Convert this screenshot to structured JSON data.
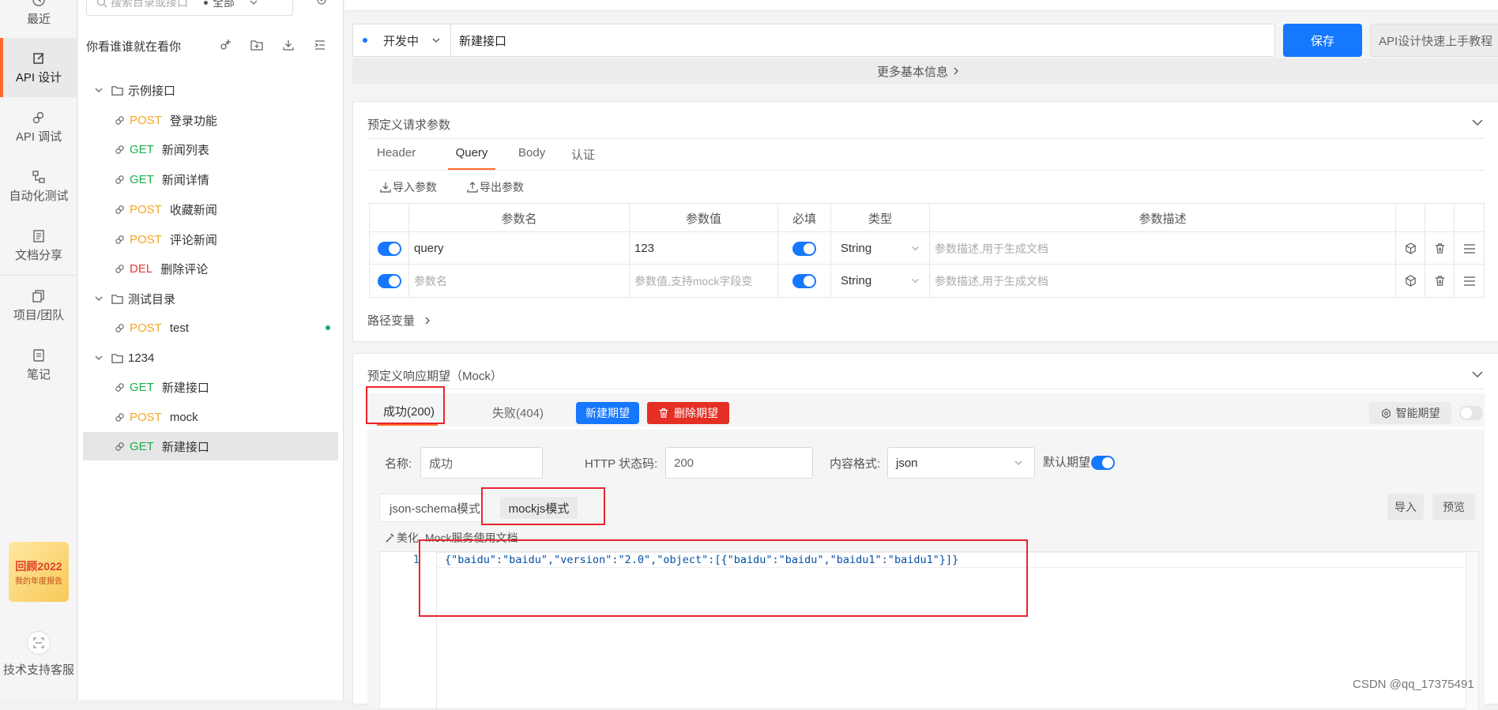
{
  "rail": {
    "items": [
      {
        "label": "最近",
        "icon": "clock-icon"
      },
      {
        "label": "API 设计",
        "icon": "edit-icon"
      },
      {
        "label": "API 调试",
        "icon": "link-icon"
      },
      {
        "label": "自动化测试",
        "icon": "flow-icon"
      },
      {
        "label": "文档分享",
        "icon": "doc-icon"
      },
      {
        "label": "项目/团队",
        "icon": "copy-icon"
      },
      {
        "label": "笔记",
        "icon": "note-icon"
      }
    ],
    "promo": {
      "line1": "回顾2022",
      "line2": "我的年度报告"
    },
    "support_label": "技术支持客服"
  },
  "tree": {
    "search_placeholder": "搜索目录或接口",
    "filter_value": "全部",
    "project_name": "你看谁谁就在看你",
    "folders": [
      {
        "name": "示例接口",
        "items": [
          {
            "method": "POST",
            "name": "登录功能"
          },
          {
            "method": "GET",
            "name": "新闻列表"
          },
          {
            "method": "GET",
            "name": "新闻详情"
          },
          {
            "method": "POST",
            "name": "收藏新闻"
          },
          {
            "method": "POST",
            "name": "评论新闻"
          },
          {
            "method": "DEL",
            "name": "删除评论"
          }
        ]
      },
      {
        "name": "测试目录",
        "items": [
          {
            "method": "POST",
            "name": "test"
          }
        ]
      },
      {
        "name": "1234",
        "items": [
          {
            "method": "GET",
            "name": "新建接口"
          },
          {
            "method": "POST",
            "name": "mock"
          },
          {
            "method": "GET",
            "name": "新建接口"
          }
        ]
      }
    ]
  },
  "topbar": {
    "status": "开发中",
    "api_name": "新建接口",
    "save_label": "保存",
    "guide_label": "API设计快速上手教程",
    "more_info": "更多基本信息"
  },
  "request": {
    "section_title": "预定义请求参数",
    "tabs": [
      "Header",
      "Query",
      "Body",
      "认证"
    ],
    "active_tab": "Query",
    "import_label": "导入参数",
    "export_label": "导出参数",
    "columns": [
      "参数名",
      "参数值",
      "必填",
      "类型",
      "参数描述"
    ],
    "rows": [
      {
        "name": "query",
        "value": "123",
        "type": "String",
        "desc_placeholder": "参数描述,用于生成文档"
      },
      {
        "name_placeholder": "参数名",
        "value_placeholder": "参数值,支持mock字段变",
        "type": "String",
        "desc_placeholder": "参数描述,用于生成文档"
      }
    ],
    "path_vars": "路径变量"
  },
  "mock": {
    "section_title": "预定义响应期望（Mock）",
    "tabs": [
      "成功(200)",
      "失败(404)"
    ],
    "new_label": "新建期望",
    "delete_label": "删除期望",
    "smart_label": "智能期望",
    "name_label": "名称:",
    "name_value": "成功",
    "status_label": "HTTP 状态码:",
    "status_value": "200",
    "format_label": "内容格式:",
    "format_value": "json",
    "default_label": "默认期望",
    "mode_tabs": [
      "json-schema模式",
      "mockjs模式"
    ],
    "import_label": "导入",
    "preview_label": "预览",
    "beautify_label": "美化",
    "doc_label": "Mock服务使用文档",
    "line_no": "1",
    "code": "{\"baidu\":\"baidu\",\"version\":\"2.0\",\"object\":[{\"baidu\":\"baidu\",\"baidu1\":\"baidu1\"}]}"
  },
  "watermark": "CSDN @qq_17375491"
}
